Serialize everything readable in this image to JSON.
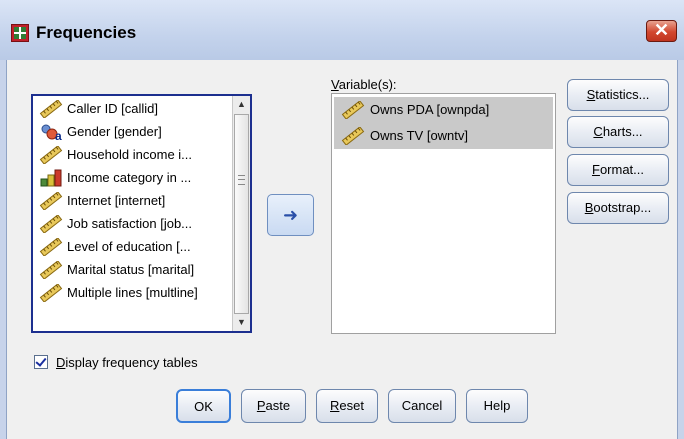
{
  "window": {
    "title": "Frequencies",
    "close_icon": "close-icon"
  },
  "source_list": {
    "items": [
      {
        "label": "Caller ID [callid]",
        "icon": "scale-ruler-icon"
      },
      {
        "label": "Gender [gender]",
        "icon": "nominal-variable-icon"
      },
      {
        "label": "Household income i...",
        "icon": "scale-ruler-icon"
      },
      {
        "label": "Income category in ...",
        "icon": "ordinal-bars-icon"
      },
      {
        "label": "Internet [internet]",
        "icon": "scale-ruler-icon"
      },
      {
        "label": "Job satisfaction [job...",
        "icon": "scale-ruler-icon"
      },
      {
        "label": "Level of education [...",
        "icon": "scale-ruler-icon"
      },
      {
        "label": "Marital status [marital]",
        "icon": "scale-ruler-icon"
      },
      {
        "label": "Multiple lines [multline]",
        "icon": "scale-ruler-icon"
      }
    ]
  },
  "move_button": {
    "icon": "arrow-right-icon"
  },
  "variables": {
    "label_first": "V",
    "label_rest": "ariable(s):",
    "items": [
      {
        "label": "Owns PDA [ownpda]",
        "icon": "scale-ruler-icon"
      },
      {
        "label": "Owns TV [owntv]",
        "icon": "scale-ruler-icon"
      }
    ]
  },
  "side_buttons": {
    "statistics": {
      "mn": "S",
      "rest": "tatistics..."
    },
    "charts": {
      "mn": "C",
      "rest": "harts..."
    },
    "format": {
      "mn": "F",
      "rest": "ormat..."
    },
    "bootstrap": {
      "mn": "B",
      "rest": "ootstrap..."
    }
  },
  "display_tables": {
    "mn": "D",
    "rest": "isplay frequency tables",
    "checked": true
  },
  "bottom_buttons": {
    "ok": "OK",
    "paste": {
      "mn": "P",
      "rest": "aste"
    },
    "reset": {
      "mn": "R",
      "rest": "eset"
    },
    "cancel": "Cancel",
    "help": "Help"
  },
  "colors": {
    "selection": "#c9c9c9",
    "list_focus_border": "#1c2f8f",
    "title_gradient": "#c4d3ec"
  }
}
